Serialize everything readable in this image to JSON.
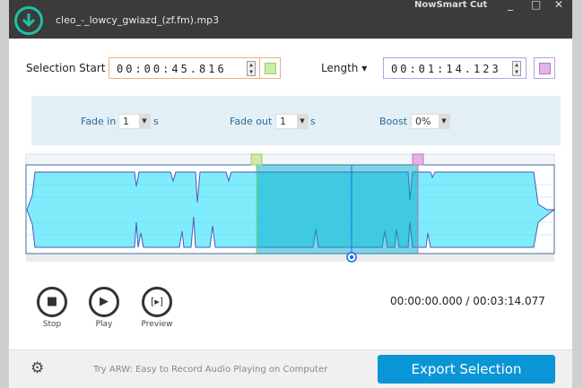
{
  "titlebar": {
    "file_name": "cleo_-_lowcy_gwiazd_(zf.fm).mp3",
    "app_name": "NowSmart Cut",
    "minimize": "_",
    "maximize": "□",
    "close": "✕"
  },
  "selection": {
    "start_label": "Selection Start",
    "start_value": "00:00:45.816",
    "length_label": "Length ▾",
    "length_value": "00:01:14.123",
    "start_color": "#cfe9a6",
    "end_color": "#e4b2e8"
  },
  "effects": {
    "fade_in_label": "Fade in",
    "fade_in_value": "1",
    "fade_in_unit": "s",
    "fade_out_label": "Fade out",
    "fade_out_value": "1",
    "fade_out_unit": "s",
    "boost_label": "Boost",
    "boost_value": "0%"
  },
  "playback": {
    "stop_label": "Stop",
    "play_label": "Play",
    "preview_label": "Preview",
    "position": "00:00:00.000 / 00:03:14.077"
  },
  "footer": {
    "promo": "Try ARW: Easy to Record Audio Playing on Computer",
    "export_label": "Export Selection"
  },
  "colors": {
    "accent": "#0a95d6",
    "waveform": "#7fecfc",
    "selection": "#00b8d8"
  }
}
